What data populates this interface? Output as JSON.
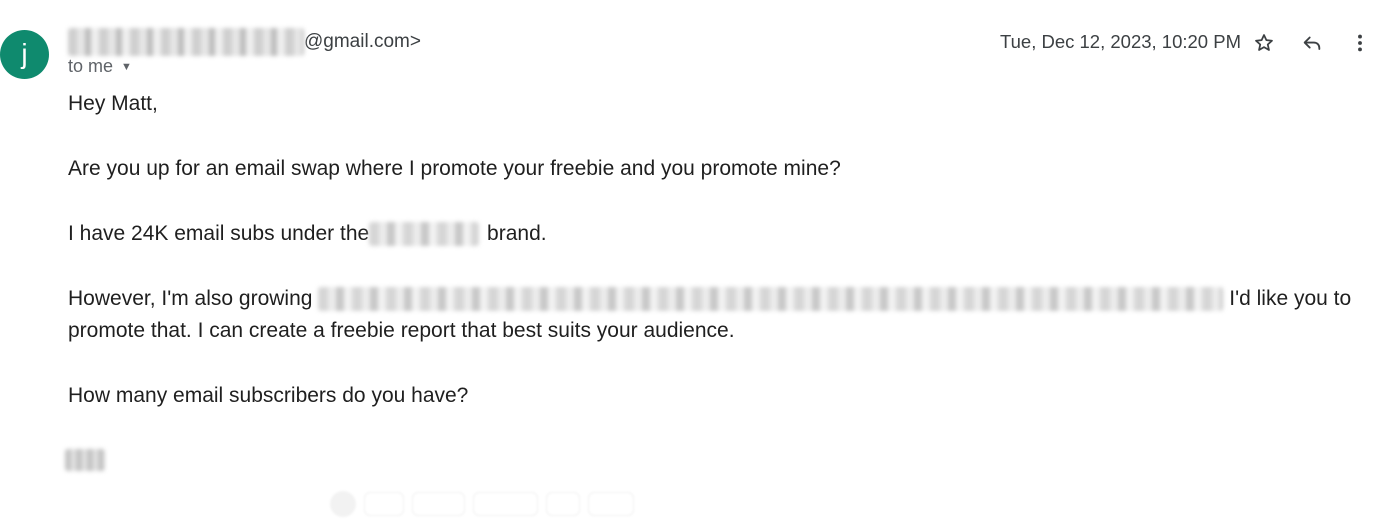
{
  "sender": {
    "avatar_letter": "j",
    "email_suffix": "@gmail.com>",
    "to_label": "to me"
  },
  "header": {
    "date": "Tue, Dec 12, 2023, 10:20 PM"
  },
  "icons": {
    "star": "star-icon",
    "reply": "reply-icon",
    "more": "more-vertical-icon",
    "caret": "chevron-down-icon"
  },
  "body": {
    "greeting": "Hey Matt,",
    "line1": "Are you up for an email swap where I promote your freebie and you promote mine?",
    "line2_before": "I have 24K email subs under the",
    "line2_after": " brand.",
    "line3_before": "However, I'm also growing ",
    "line3_after": "I'd like you to promote that. I can create a freebie report that best suits your audience.",
    "line4": "How many email subscribers do you have?"
  },
  "colors": {
    "avatar": "#0f8a6e",
    "text": "#1f1f1f",
    "muted": "#5f6368"
  }
}
